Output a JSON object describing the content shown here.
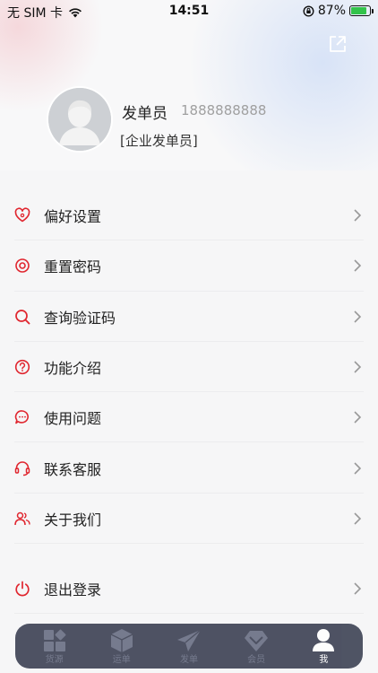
{
  "status_bar": {
    "carrier": "无 SIM 卡",
    "time": "14:51",
    "battery_percent": "87%",
    "battery_level": 0.87
  },
  "profile": {
    "name": "发单员",
    "phone": "1888888888",
    "role": "[企业发单员]"
  },
  "menu": {
    "items": [
      {
        "label": "偏好设置",
        "icon": "heart-settings-icon"
      },
      {
        "label": "重置密码",
        "icon": "reset-ring-icon"
      },
      {
        "label": "查询验证码",
        "icon": "search-icon"
      },
      {
        "label": "功能介绍",
        "icon": "question-icon"
      },
      {
        "label": "使用问题",
        "icon": "chat-bubble-icon"
      },
      {
        "label": "联系客服",
        "icon": "headset-icon"
      },
      {
        "label": "关于我们",
        "icon": "users-icon"
      }
    ],
    "logout": {
      "label": "退出登录",
      "icon": "power-icon"
    }
  },
  "tabbar": {
    "tabs": [
      {
        "label": "货源",
        "icon": "grid-icon",
        "active": false
      },
      {
        "label": "运单",
        "icon": "box-icon",
        "active": false
      },
      {
        "label": "发单",
        "icon": "paper-plane-icon",
        "active": false
      },
      {
        "label": "会员",
        "icon": "diamond-icon",
        "active": false
      },
      {
        "label": "我",
        "icon": "person-icon",
        "active": true
      }
    ]
  },
  "colors": {
    "accent": "#e0262f",
    "tabbar_bg": "#2a2f43",
    "battery": "#32c34a"
  }
}
